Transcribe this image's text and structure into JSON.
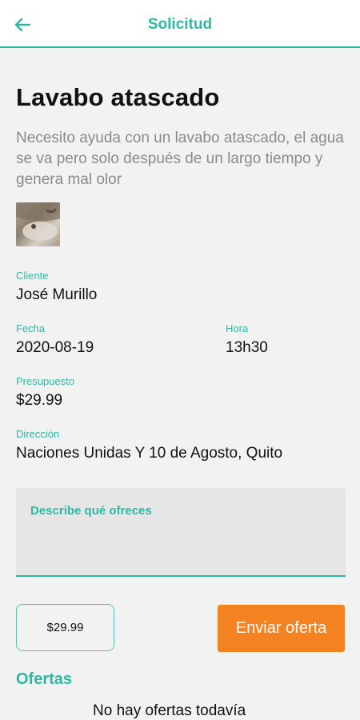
{
  "header": {
    "title": "Solicitud",
    "back_icon": "arrow-left-icon",
    "accent": "#2db8a2"
  },
  "request": {
    "title": "Lavabo atascado",
    "description": "Necesito ayuda con un lavabo atascado, el agua se va pero solo después de un largo tiempo y genera mal olor",
    "fields": {
      "client_label": "Cliente",
      "client_value": "José Murillo",
      "date_label": "Fecha",
      "date_value": "2020-08-19",
      "time_label": "Hora",
      "time_value": "13h30",
      "budget_label": "Presupuesto",
      "budget_value": "$29.99",
      "address_label": "Dirección",
      "address_value": "Naciones Unidas Y 10 de Agosto, Quito"
    }
  },
  "offer_form": {
    "description_label": "Describe qué ofreces",
    "description_value": "",
    "price_value": "$29.99",
    "send_label": "Enviar oferta",
    "send_color": "#f58220"
  },
  "offers": {
    "title": "Ofertas",
    "empty_text": "No hay ofertas todavía"
  }
}
